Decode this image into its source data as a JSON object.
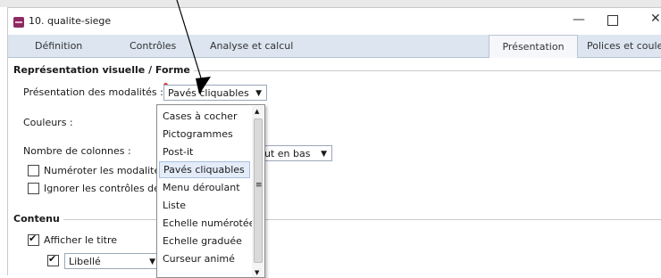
{
  "window": {
    "title": "10. qualite-siege",
    "controls": {
      "minimize": "—",
      "close": "✕"
    }
  },
  "tabs": [
    {
      "label": "Définition"
    },
    {
      "label": "Contrôles"
    },
    {
      "label": "Analyse et calcul"
    },
    {
      "label": "Présentation",
      "active": true
    },
    {
      "label": "Polices et couleurs"
    }
  ],
  "representation": {
    "section_title": "Représentation visuelle / Forme",
    "presentation_label": "Présentation des modalités :",
    "presentation_value": "Pavés cliquables",
    "couleurs_label": "Couleurs :",
    "colonnes_label": "Nombre de colonnes :",
    "layout_value": "ut en bas",
    "numeroter_label": "Numéroter les modalités",
    "ignorer_label": "Ignorer les contrôles de"
  },
  "dropdown": {
    "options": [
      "Cases à cocher",
      "Pictogrammes",
      "Post-it",
      "Pavés cliquables",
      "Menu déroulant",
      "Liste",
      "Echelle numérotée",
      "Echelle graduée",
      "Curseur animé"
    ],
    "selected": "Pavés cliquables",
    "grip": "≡"
  },
  "contenu": {
    "section_title": "Contenu",
    "afficher_titre_label": "Afficher le titre",
    "libelle_value": "Libellé"
  },
  "colors": {
    "tab_bar": "#dce5f0",
    "selected_item": "#e3ecf8",
    "app_icon": "#8e2a62"
  }
}
